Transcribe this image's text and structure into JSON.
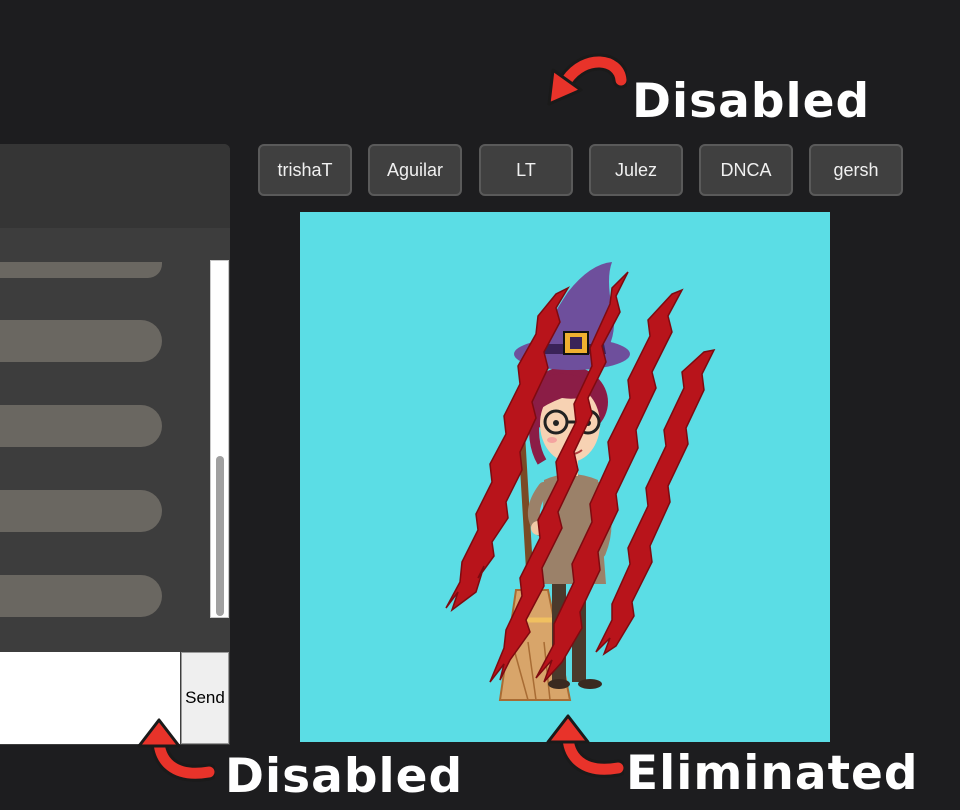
{
  "players": [
    {
      "name": "trishaT"
    },
    {
      "name": "Aguilar"
    },
    {
      "name": "LT"
    },
    {
      "name": "Julez"
    },
    {
      "name": "DNCA"
    },
    {
      "name": "gersh"
    }
  ],
  "chat": {
    "input_value": "",
    "send_label": "Send"
  },
  "annotations": {
    "top_right": "Disabled",
    "bottom_left": "Disabled",
    "bottom_right": "Eliminated"
  },
  "avatar": {
    "icon": "witch-avatar-icon",
    "overlay_icon": "claw-scratch-icon"
  },
  "colors": {
    "background": "#1d1d1f",
    "avatar_bg": "#5bdde5",
    "arrow": "#e8332a",
    "scratch": "#b8141b",
    "button_bg": "#404040"
  }
}
